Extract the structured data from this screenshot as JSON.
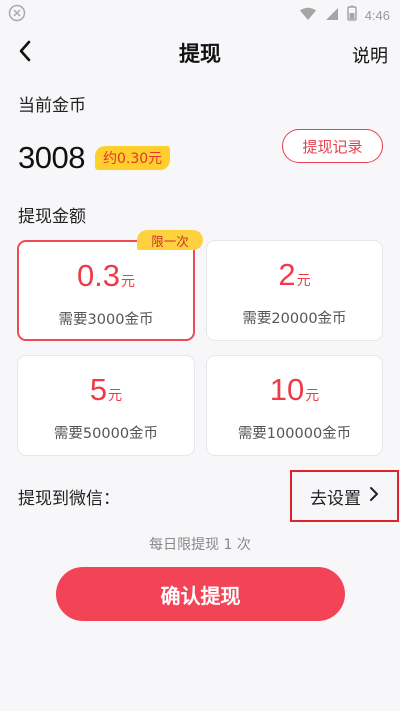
{
  "status_bar": {
    "time": "4:46"
  },
  "nav": {
    "title": "提现",
    "help_label": "说明"
  },
  "balance": {
    "label": "当前金币",
    "amount": "3008",
    "approx": "约0.30元",
    "record_button": "提现记录"
  },
  "withdraw": {
    "label": "提现金额",
    "limit_badge": "限一次",
    "options": [
      {
        "amount": "0.3",
        "unit": "元",
        "need": "需要3000金币"
      },
      {
        "amount": "2",
        "unit": "元",
        "need": "需要20000金币"
      },
      {
        "amount": "5",
        "unit": "元",
        "need": "需要50000金币"
      },
      {
        "amount": "10",
        "unit": "元",
        "need": "需要100000金币"
      }
    ]
  },
  "wechat": {
    "label": "提现到微信：",
    "setup_label": "去设置"
  },
  "daily_limit": "每日限提现 1 次",
  "confirm_label": "确认提现",
  "colors": {
    "accent": "#f24456",
    "badge_yellow": "#ffcf2e"
  }
}
